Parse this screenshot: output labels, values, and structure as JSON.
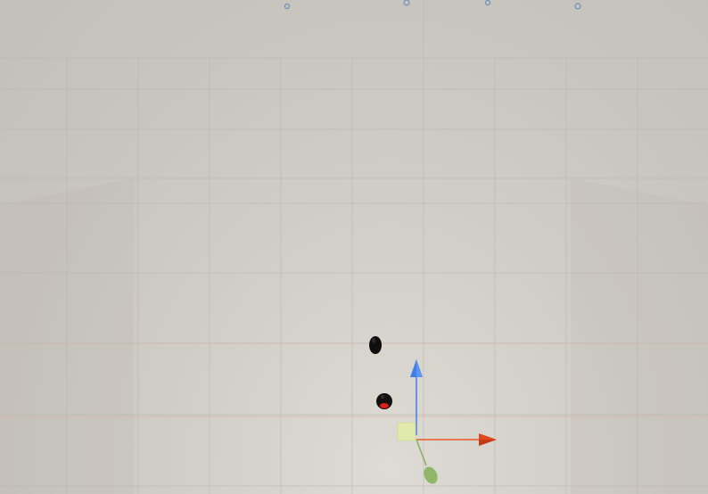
{
  "scene": {
    "view": "perspective",
    "colors": {
      "background": "#c9c5bf",
      "grid_line": "#b5b1ab",
      "grid_major": "#c9b9ad",
      "axis_x": "#f0582a",
      "axis_y": "#3f7fe8",
      "axis_z": "#87b25d",
      "plane_handle": "#e0eca8",
      "camera_marker": "#6f8fbf",
      "object_dark": "#0f0f0f",
      "object_glow": "#d9201a"
    },
    "objects": [
      {
        "name": "ellipsoid-object",
        "color": "object_dark"
      },
      {
        "name": "sphere-object-red-glow",
        "color": "object_glow"
      }
    ],
    "gizmo": {
      "tool": "move",
      "axes": [
        "x",
        "y",
        "z"
      ],
      "icons": [
        "x-axis-arrow-icon",
        "y-axis-arrow-icon",
        "z-axis-handle-icon",
        "xy-plane-handle-icon"
      ]
    },
    "markers": [
      "camera-marker-icon",
      "camera-marker-icon",
      "camera-marker-icon",
      "camera-marker-icon"
    ]
  }
}
